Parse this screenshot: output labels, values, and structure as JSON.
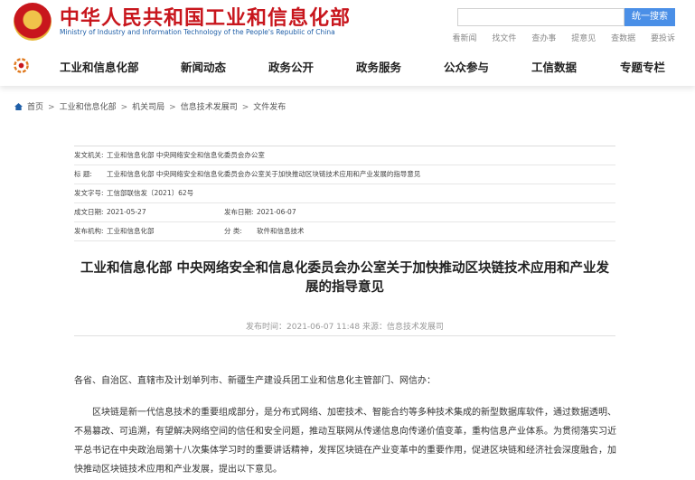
{
  "header": {
    "site_name_cn": "中华人民共和国工业和信息化部",
    "site_name_en": "Ministry of Industry and Information Technology of the People's Republic of China",
    "search_placeholder": "",
    "search_button": "统一搜索",
    "top_links": [
      "看新闻",
      "找文件",
      "查办事",
      "提意见",
      "查数据",
      "要投诉"
    ],
    "emblem_icon": "national-emblem-icon",
    "home_icon": "home-logo-icon"
  },
  "nav": {
    "items": [
      "工业和信息化部",
      "新闻动态",
      "政务公开",
      "政务服务",
      "公众参与",
      "工信数据",
      "专题专栏"
    ]
  },
  "breadcrumb": [
    "首页",
    "工业和信息化部",
    "机关司局",
    "信息技术发展司",
    "文件发布"
  ],
  "meta": {
    "issuer_label": "发文机关:",
    "issuer_value": "工业和信息化部 中央网络安全和信息化委员会办公室",
    "title_label": "标    题:",
    "title_value": "工业和信息化部 中央网络安全和信息化委员会办公室关于加快推动区块链技术应用和产业发展的指导意见",
    "doc_no_label": "发文字号:",
    "doc_no_value": "工信部联信发〔2021〕62号",
    "created_label": "成文日期:",
    "created_value": "2021-05-27",
    "published_label": "发布日期:",
    "published_value": "2021-06-07",
    "org_label": "发布机构:",
    "org_value": "工业和信息化部",
    "category_label": "分    类:",
    "category_value": "软件和信息技术"
  },
  "article": {
    "title": "工业和信息化部 中央网络安全和信息化委员会办公室关于加快推动区块链技术应用和产业发展的指导意见",
    "pubinfo": "发布时间：2021-06-07 11:48  来源：信息技术发展司",
    "addressee": "各省、自治区、直辖市及计划单列市、新疆生产建设兵团工业和信息化主管部门、网信办：",
    "paragraph1": "区块链是新一代信息技术的重要组成部分，是分布式网络、加密技术、智能合约等多种技术集成的新型数据库软件，通过数据透明、不易篡改、可追溯，有望解决网络空间的信任和安全问题，推动互联网从传递信息向传递价值变革，重构信息产业体系。为贯彻落实习近平总书记在中央政治局第十八次集体学习时的重要讲话精神，发挥区块链在产业变革中的重要作用，促进区块链和经济社会深度融合，加快推动区块链技术应用和产业发展，提出以下意见。"
  }
}
